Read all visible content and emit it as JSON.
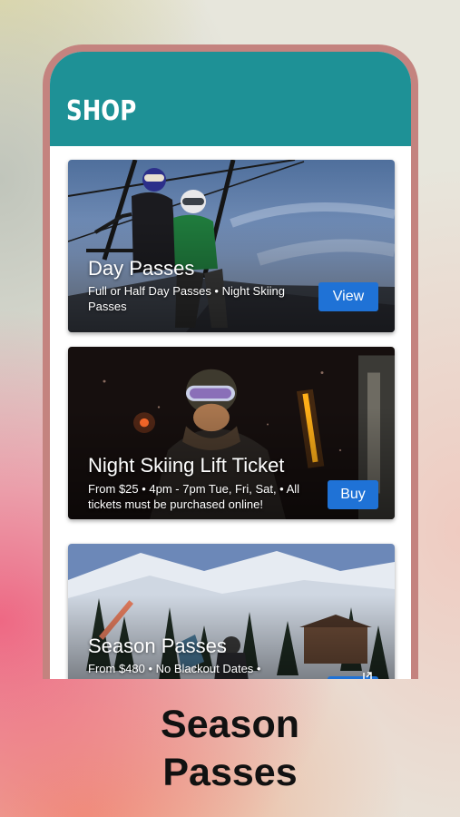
{
  "app": {
    "header_title": "SHOP"
  },
  "cards": [
    {
      "title": "Day Passes",
      "subtitle": "Full or Half Day Passes • Night Skiing Passes",
      "button": "View"
    },
    {
      "title": "Night Skiing Lift Ticket",
      "subtitle": "From $25 • 4pm - 7pm Tue, Fri, Sat, • All tickets must be purchased online!",
      "button": "Buy"
    },
    {
      "title": "Season Passes",
      "subtitle": "From $480 • No Blackout Dates •",
      "button": ""
    }
  ],
  "caption": {
    "line1": "Season",
    "line2": "Passes"
  },
  "colors": {
    "header": "#1e9196",
    "button": "#1f72d6",
    "frame": "#c4837f"
  }
}
